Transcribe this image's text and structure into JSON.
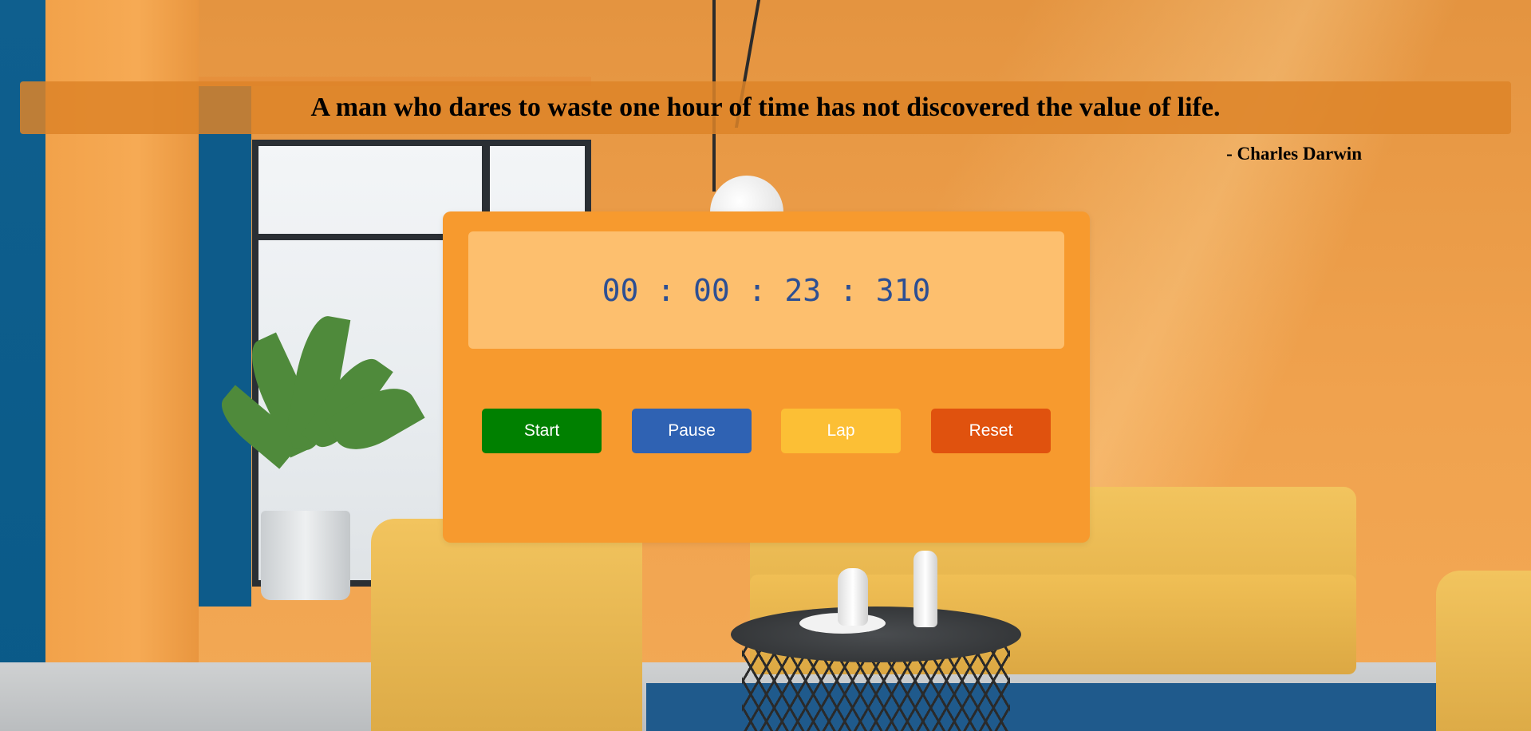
{
  "quote": {
    "text": "A man who dares to waste one hour of time has not discovered the value of life.",
    "author": "- Charles Darwin"
  },
  "stopwatch": {
    "time_display": "00 : 00 : 23 : 310"
  },
  "controls": {
    "start_label": "Start",
    "pause_label": "Pause",
    "lap_label": "Lap",
    "reset_label": "Reset"
  },
  "colors": {
    "card_background": "#f79a2e",
    "display_background": "#fdbf6e",
    "display_text": "#2d4f93",
    "start": "#008000",
    "pause": "#2f62b3",
    "lap": "#fcbf35",
    "reset": "#e0520e"
  }
}
